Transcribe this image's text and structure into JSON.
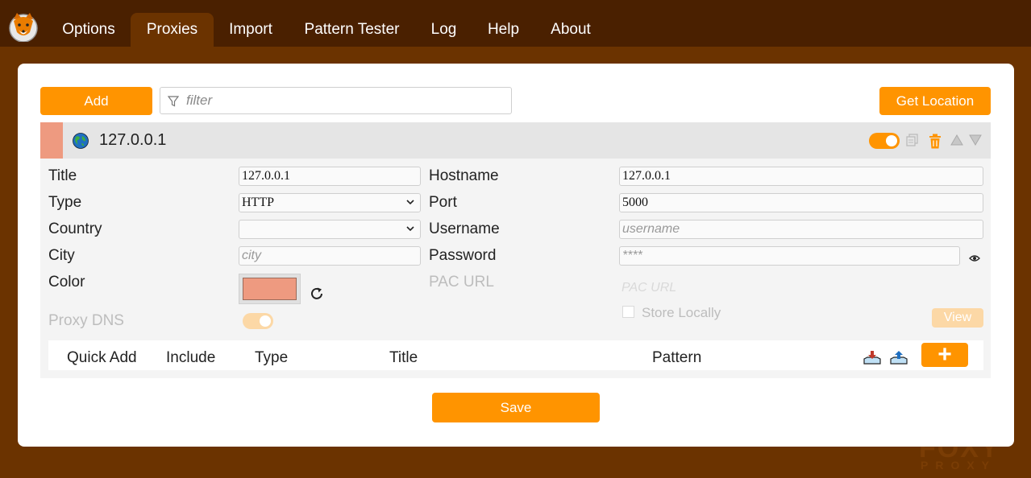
{
  "nav": {
    "tabs": [
      {
        "label": "Options",
        "active": false
      },
      {
        "label": "Proxies",
        "active": true
      },
      {
        "label": "Import",
        "active": false
      },
      {
        "label": "Pattern Tester",
        "active": false
      },
      {
        "label": "Log",
        "active": false
      },
      {
        "label": "Help",
        "active": false
      },
      {
        "label": "About",
        "active": false
      }
    ]
  },
  "toolbar": {
    "add_label": "Add",
    "filter_placeholder": "filter",
    "get_location_label": "Get Location"
  },
  "proxy": {
    "header_title": "127.0.0.1",
    "enabled": true,
    "color": "#ee9a80",
    "fields": {
      "title_label": "Title",
      "title_value": "127.0.0.1",
      "type_label": "Type",
      "type_value": "HTTP",
      "country_label": "Country",
      "country_value": "",
      "city_label": "City",
      "city_placeholder": "city",
      "color_label": "Color",
      "proxy_dns_label": "Proxy DNS",
      "hostname_label": "Hostname",
      "hostname_value": "127.0.0.1",
      "port_label": "Port",
      "port_value": "5000",
      "username_label": "Username",
      "username_placeholder": "username",
      "password_label": "Password",
      "password_placeholder": "****",
      "pac_url_label": "PAC URL",
      "pac_url_placeholder": "PAC URL",
      "store_locally_label": "Store Locally",
      "view_label": "View"
    },
    "pattern_table": {
      "columns": [
        "Quick Add",
        "Include",
        "Type",
        "Title",
        "Pattern"
      ],
      "add_label": "+"
    }
  },
  "save_label": "Save",
  "watermark": {
    "line1": "FOXY",
    "line2": "PROXY"
  },
  "colors": {
    "accent": "#ff9400",
    "background": "#6b3300",
    "topbar": "#4a2000",
    "proxy_color": "#ee9a80"
  }
}
